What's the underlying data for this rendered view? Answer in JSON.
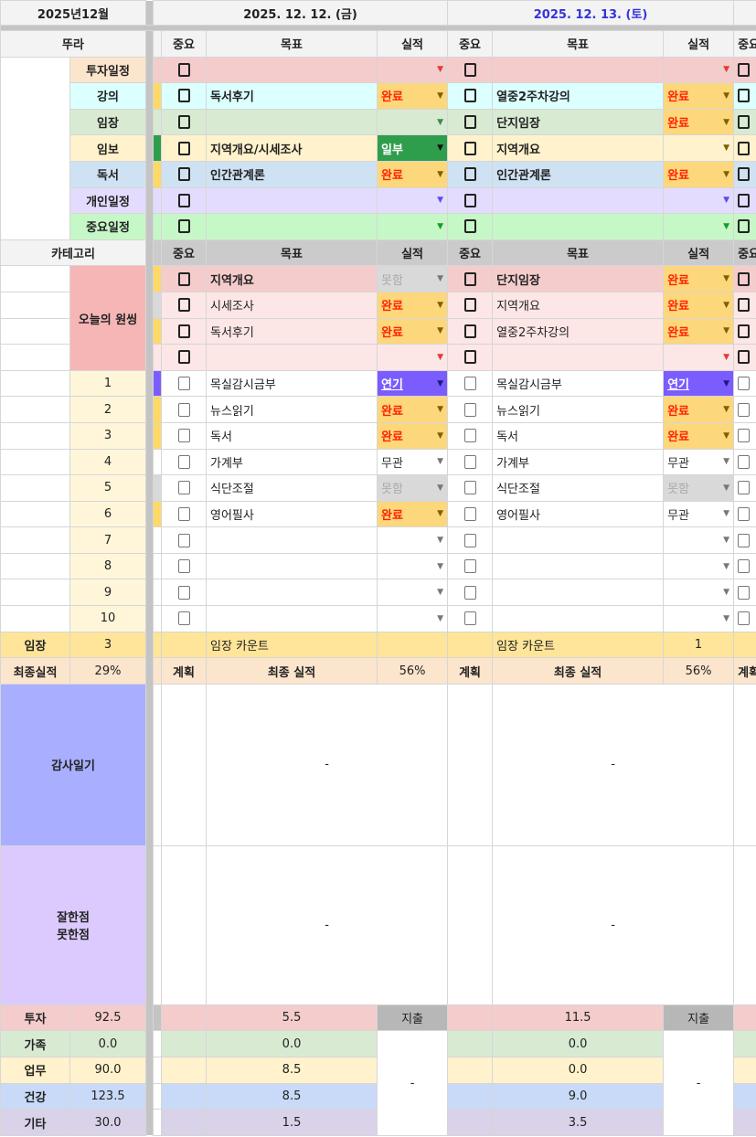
{
  "header": {
    "month": "2025년12월",
    "days": [
      {
        "date": "2025. 12. 12. (금)",
        "color": "#222222"
      },
      {
        "date": "2025. 12. 13. (토)",
        "color": "#3333dd"
      }
    ]
  },
  "columns": {
    "important": "중요",
    "goal": "목표",
    "result": "실적"
  },
  "status_styles": {
    "완료": {
      "bg": "#fdd77c",
      "text": "#ff2200",
      "arrow": "#7f6000"
    },
    "일부": {
      "bg": "#2f9e4c",
      "text": "#ffffff",
      "arrow": "#111111"
    },
    "연기": {
      "bg": "#7a5cff",
      "text": "#ffffff",
      "arrow": "#1a1a80",
      "underline": true
    },
    "못함": {
      "bg": "#d9d9d9",
      "text": "#aaaaaa",
      "arrow": "#777777"
    },
    "무관": {
      "bg": "",
      "text": "#333333",
      "arrow": "#777777"
    }
  },
  "schedule": {
    "label": "뚜라",
    "rows": [
      {
        "category": "투자일정",
        "cat_bg": "#fce5cd",
        "row_bg": "#f4cccc",
        "arrow": "#e53935",
        "stripe": "#f4cccc",
        "days": [
          {
            "goal": "",
            "result": ""
          },
          {
            "goal": "",
            "result": ""
          }
        ]
      },
      {
        "category": "강의",
        "cat_bg": "#dcffff",
        "row_bg": "#dcffff",
        "arrow": "#7f6000",
        "stripe": "#ffd966",
        "days": [
          {
            "goal": "독서후기",
            "result": "완료"
          },
          {
            "goal": "열중2주차강의",
            "result": "완료"
          }
        ]
      },
      {
        "category": "임장",
        "cat_bg": "#d9ead3",
        "row_bg": "#d9ead3",
        "arrow": "#3c8c4a",
        "stripe": "#d9ead3",
        "days": [
          {
            "goal": "",
            "result": ""
          },
          {
            "goal": "단지임장",
            "result": "완료"
          }
        ]
      },
      {
        "category": "임보",
        "cat_bg": "#fff2cc",
        "row_bg": "#fff2cc",
        "arrow": "#7f6000",
        "stripe": "#2f9e4c",
        "days": [
          {
            "goal": "지역개요/시세조사",
            "result": "일부"
          },
          {
            "goal": "지역개요",
            "result": ""
          }
        ]
      },
      {
        "category": "독서",
        "cat_bg": "#cfe2f3",
        "row_bg": "#cfe2f3",
        "arrow": "#7f6000",
        "stripe": "#ffd966",
        "days": [
          {
            "goal": "인간관계론",
            "result": "완료"
          },
          {
            "goal": "인간관계론",
            "result": "완료"
          }
        ]
      },
      {
        "category": "개인일정",
        "cat_bg": "#e4dcff",
        "row_bg": "#e4dcff",
        "arrow": "#5b4cf0",
        "stripe": "#e4dcff",
        "days": [
          {
            "goal": "",
            "result": ""
          },
          {
            "goal": "",
            "result": ""
          }
        ]
      },
      {
        "category": "중요일정",
        "cat_bg": "#c6f7c6",
        "row_bg": "#c6f7c6",
        "arrow": "#1a9a2a",
        "stripe": "#c6f7c6",
        "days": [
          {
            "goal": "",
            "result": ""
          },
          {
            "goal": "",
            "result": ""
          }
        ]
      }
    ]
  },
  "onething": {
    "header_label": "카테고리",
    "label": "오늘의 원씽",
    "label_bg": "#f7b6b6",
    "rows": [
      {
        "row_bg": "#f4cccc",
        "bold": true,
        "stripe": "#ffd966",
        "arrow": "#e53935",
        "days": [
          {
            "goal": "지역개요",
            "result": "못함"
          },
          {
            "goal": "단지임장",
            "result": "완료"
          }
        ]
      },
      {
        "row_bg": "#fde6e6",
        "bold": false,
        "stripe": "#d9d9d9",
        "arrow": "#e53935",
        "days": [
          {
            "goal": "시세조사",
            "result": "완료"
          },
          {
            "goal": "지역개요",
            "result": "완료"
          }
        ]
      },
      {
        "row_bg": "#fde6e6",
        "bold": false,
        "stripe": "#ffd966",
        "arrow": "#e53935",
        "days": [
          {
            "goal": "독서후기",
            "result": "완료"
          },
          {
            "goal": "열중2주차강의",
            "result": "완료"
          }
        ]
      },
      {
        "row_bg": "#fde6e6",
        "bold": false,
        "stripe": "#fde6e6",
        "arrow": "#e53935",
        "days": [
          {
            "goal": "",
            "result": ""
          },
          {
            "goal": "",
            "result": ""
          }
        ]
      }
    ]
  },
  "routine": {
    "num_bg": "#fff6da",
    "rows": [
      {
        "num": "1",
        "stripe": "#7a5cff",
        "days": [
          {
            "goal": "목실감시금부",
            "result": "연기"
          },
          {
            "goal": "목실감시금부",
            "result": "연기"
          }
        ]
      },
      {
        "num": "2",
        "stripe": "#ffd966",
        "days": [
          {
            "goal": "뉴스읽기",
            "result": "완료"
          },
          {
            "goal": "뉴스읽기",
            "result": "완료"
          }
        ]
      },
      {
        "num": "3",
        "stripe": "#ffd966",
        "days": [
          {
            "goal": "독서",
            "result": "완료"
          },
          {
            "goal": "독서",
            "result": "완료"
          }
        ]
      },
      {
        "num": "4",
        "stripe": "",
        "days": [
          {
            "goal": "가계부",
            "result": "무관"
          },
          {
            "goal": "가계부",
            "result": "무관"
          }
        ]
      },
      {
        "num": "5",
        "stripe": "#d9d9d9",
        "days": [
          {
            "goal": "식단조절",
            "result": "못함"
          },
          {
            "goal": "식단조절",
            "result": "못함"
          }
        ]
      },
      {
        "num": "6",
        "stripe": "#ffd966",
        "days": [
          {
            "goal": "영어필사",
            "result": "완료"
          },
          {
            "goal": "영어필사",
            "result": "무관"
          }
        ]
      },
      {
        "num": "7",
        "stripe": "",
        "days": [
          {
            "goal": "",
            "result": ""
          },
          {
            "goal": "",
            "result": ""
          }
        ]
      },
      {
        "num": "8",
        "stripe": "",
        "days": [
          {
            "goal": "",
            "result": ""
          },
          {
            "goal": "",
            "result": ""
          }
        ]
      },
      {
        "num": "9",
        "stripe": "",
        "days": [
          {
            "goal": "",
            "result": ""
          },
          {
            "goal": "",
            "result": ""
          }
        ]
      },
      {
        "num": "10",
        "stripe": "",
        "days": [
          {
            "goal": "",
            "result": ""
          },
          {
            "goal": "",
            "result": ""
          }
        ]
      }
    ]
  },
  "imjang": {
    "label": "임장",
    "total": "3",
    "bg": "#ffe599",
    "days": [
      {
        "label": "임장 카운트",
        "value": ""
      },
      {
        "label": "임장 카운트",
        "value": "1"
      }
    ]
  },
  "final": {
    "label": "최종실적",
    "total": "29%",
    "bg": "#fce5cd",
    "days": [
      {
        "plan": "계획",
        "label": "최종 실적",
        "value": "56%"
      },
      {
        "plan": "계획",
        "label": "최종 실적",
        "value": "56%"
      }
    ]
  },
  "gratitude": {
    "label": "감사일기",
    "bg": "#a9aeff",
    "days": [
      "-",
      "-"
    ]
  },
  "review": {
    "label_line1": "잘한점",
    "label_line2": "못한점",
    "bg": "#dccaff",
    "days": [
      "-",
      "-"
    ]
  },
  "expenses": {
    "header": "지출",
    "notes": [
      "-",
      "-"
    ],
    "rows": [
      {
        "label": "투자",
        "total": "92.5",
        "bg": "#f4cccc",
        "days": [
          "5.5",
          "11.5"
        ]
      },
      {
        "label": "가족",
        "total": "0.0",
        "bg": "#d9ead3",
        "days": [
          "0.0",
          "0.0"
        ]
      },
      {
        "label": "업무",
        "total": "90.0",
        "bg": "#fff2cc",
        "days": [
          "8.5",
          "0.0"
        ]
      },
      {
        "label": "건강",
        "total": "123.5",
        "bg": "#c9daf8",
        "days": [
          "8.5",
          "9.0"
        ]
      },
      {
        "label": "기타",
        "total": "30.0",
        "bg": "#d9d2e9",
        "days": [
          "1.5",
          "3.5"
        ]
      }
    ]
  }
}
